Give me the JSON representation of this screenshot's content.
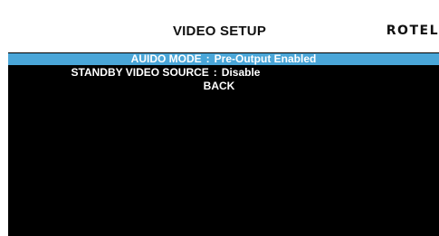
{
  "header": {
    "title": "VIDEO SETUP",
    "brand": "ROTEL"
  },
  "menu": {
    "items": [
      {
        "label": "AUIDO MODE",
        "separator": ":",
        "value": "Pre-Output Enabled",
        "selected": true
      },
      {
        "label": "STANDBY VIDEO SOURCE",
        "separator": ":",
        "value": "Disable",
        "selected": false
      },
      {
        "label": "BACK",
        "selected": false
      }
    ],
    "highlight_color": "#4aa6d8"
  }
}
